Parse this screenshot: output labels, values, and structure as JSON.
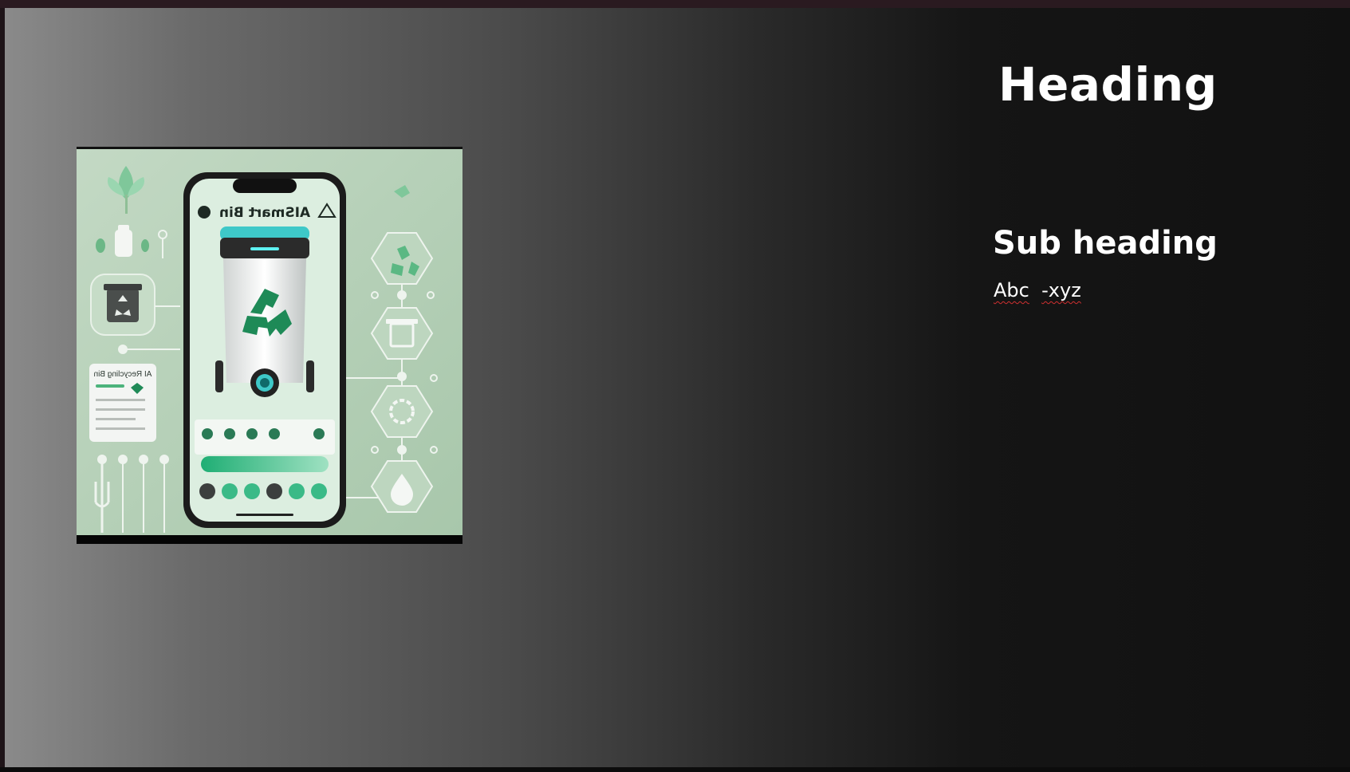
{
  "slide": {
    "heading": "Heading",
    "subheading": "Sub heading",
    "body_word1": "Abc",
    "body_word2": "-xyz"
  },
  "image": {
    "description_icon": "smart-bin-app-illustration",
    "phone_title": "AISmart Bin",
    "card_title": "AI Recycling Bin",
    "colors": {
      "bg": "#b5cfb7",
      "green": "#2a8a5a",
      "accent": "#3ec8c8"
    }
  }
}
